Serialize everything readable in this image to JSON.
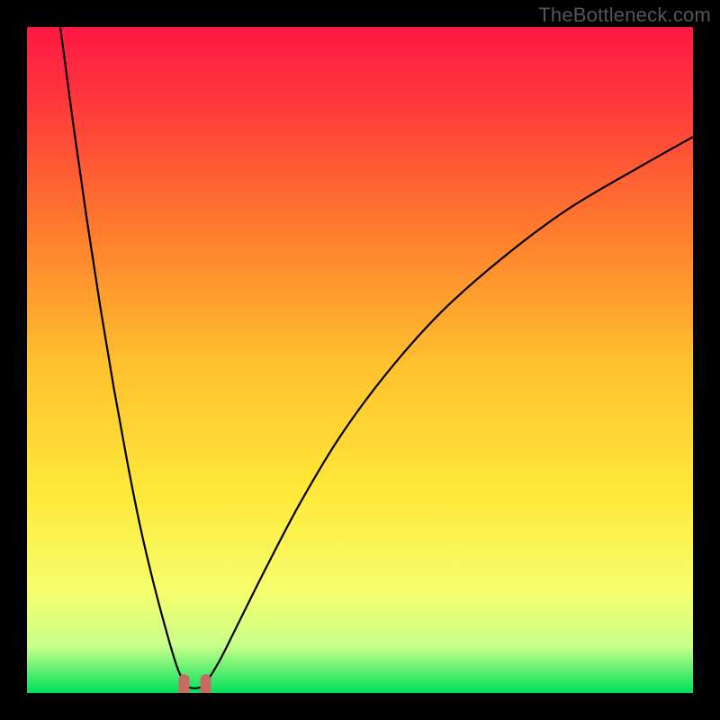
{
  "watermark": "TheBottleneck.com",
  "chart_data": {
    "type": "line",
    "title": "",
    "xlabel": "",
    "ylabel": "",
    "xlim": [
      0,
      100
    ],
    "ylim": [
      0,
      100
    ],
    "background_gradient": {
      "stops": [
        {
          "pos": 0.0,
          "color": "#ff1744"
        },
        {
          "pos": 0.12,
          "color": "#ff3b3b"
        },
        {
          "pos": 0.3,
          "color": "#ff7a2e"
        },
        {
          "pos": 0.5,
          "color": "#ffbf2e"
        },
        {
          "pos": 0.7,
          "color": "#ffe93a"
        },
        {
          "pos": 0.85,
          "color": "#f6ff6e"
        },
        {
          "pos": 0.93,
          "color": "#c6ff8a"
        },
        {
          "pos": 1.0,
          "color": "#00e05a"
        }
      ]
    },
    "series": [
      {
        "name": "left_descent",
        "x": [
          5,
          7,
          9,
          11,
          13,
          15,
          17,
          19,
          21,
          22.5,
          23.5
        ],
        "values": [
          100,
          85,
          71,
          58,
          46,
          35,
          25,
          16.5,
          9,
          4,
          1.7
        ]
      },
      {
        "name": "trough",
        "x": [
          23.5,
          24.3,
          25.2,
          26.1,
          27.0
        ],
        "values": [
          1.7,
          0.9,
          0.7,
          0.9,
          1.7
        ]
      },
      {
        "name": "right_ascent",
        "x": [
          27.0,
          29,
          32,
          36,
          41,
          47,
          54,
          62,
          71,
          81,
          92,
          100
        ],
        "values": [
          1.7,
          5,
          11,
          19,
          28.5,
          38.5,
          48,
          57,
          65,
          72.5,
          79,
          83.5
        ]
      }
    ],
    "trough_marker": {
      "x": 25.2,
      "y": 1.2,
      "color": "#c76a63"
    }
  }
}
